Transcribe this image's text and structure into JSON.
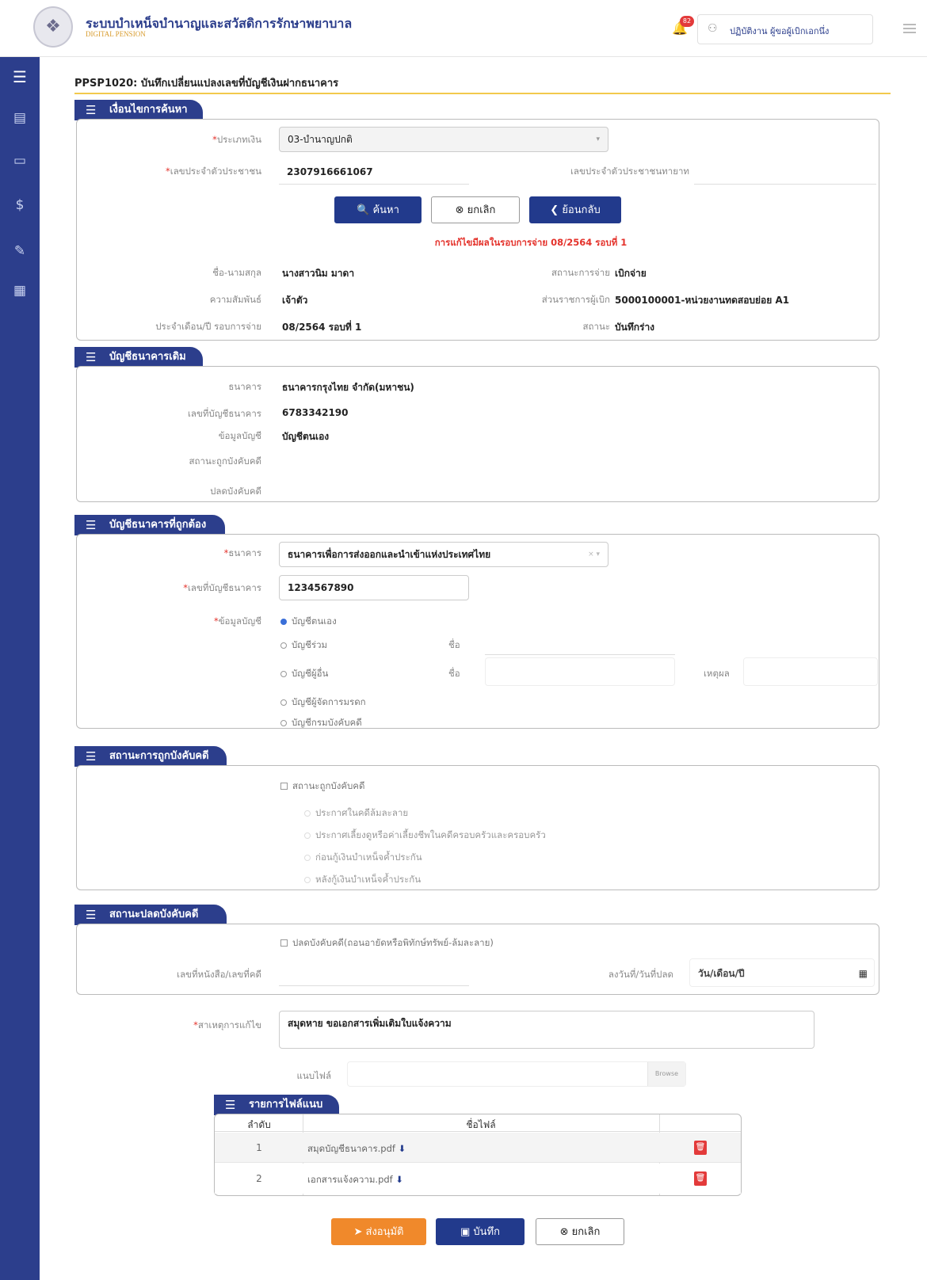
{
  "header": {
    "title": "ระบบบำเหน็จบำนาญและสวัสดิการรักษาพยาบาล",
    "subtitle": "DIGITAL PENSION",
    "notification_count": "82",
    "user_name": "ปฏิบัติงาน ผู้ขอผู้เบิกเอกนึ่ง"
  },
  "page": {
    "title": "PPSP1020: บันทึกเปลี่ยนแปลงเลขที่บัญชีเงินฝากธนาคาร"
  },
  "search": {
    "section_title": "เงื่อนไขการค้นหา",
    "type_label": "ประเภทเงิน",
    "type_value": "03-บำนาญปกติ",
    "id_label": "เลขประจำตัวประชาชน",
    "id_value": "2307916661067",
    "heir_id_label": "เลขประจำตัวประชาชนทายาท",
    "search_btn": "ค้นหา",
    "cancel_btn": "ยกเลิก",
    "back_btn": "ย้อนกลับ",
    "notice": "การแก้ไขมีผลในรอบการจ่าย 08/2564 รอบที่ 1"
  },
  "info": {
    "name_label": "ชื่อ-นามสกุล",
    "name_value": "นางสาวนิม มาดา",
    "pay_status_label": "สถานะการจ่าย",
    "pay_status_value": "เบิกจ่าย",
    "relation_label": "ความสัมพันธ์",
    "relation_value": "เจ้าตัว",
    "unit_label": "ส่วนราชการผู้เบิก",
    "unit_value": "5000100001-หน่วยงานทดสอบย่อย A1",
    "period_label": "ประจำเดือน/ปี รอบการจ่าย",
    "period_value": "08/2564 รอบที่ 1",
    "status_label": "สถานะ",
    "status_value": "บันทึกร่าง"
  },
  "old_bank": {
    "section_title": "บัญชีธนาคารเดิม",
    "bank_label": "ธนาคาร",
    "bank_value": "ธนาคารกรุงไทย จำกัด(มหาชน)",
    "acc_label": "เลขที่บัญชีธนาคาร",
    "acc_value": "6783342190",
    "acc_type_label": "ข้อมูลบัญชี",
    "acc_type_value": "บัญชีตนเอง",
    "enforce_label": "สถานะถูกบังคับคดี",
    "release_label": "ปลดบังคับคดี"
  },
  "new_bank": {
    "section_title": "บัญชีธนาคารที่ถูกต้อง",
    "bank_label": "ธนาคาร",
    "bank_value": "ธนาคารเพื่อการส่งออกและนำเข้าแห่งประเทศไทย",
    "acc_label": "เลขที่บัญชีธนาคาร",
    "acc_value": "1234567890",
    "acc_type_label": "ข้อมูลบัญชี",
    "opt_self": "บัญชีตนเอง",
    "opt_joint": "บัญชีร่วม",
    "opt_other": "บัญชีผู้อื่น",
    "opt_estate": "บัญชีผู้จัดการมรดก",
    "opt_enforce": "บัญชีกรมบังคับคดี",
    "name_label": "ชื่อ",
    "reason_label": "เหตุผล"
  },
  "enforce": {
    "section_title": "สถานะการถูกบังคับคดี",
    "check_label": "สถานะถูกบังคับคดี",
    "opt1": "ประกาศในคดีล้มละลาย",
    "opt2": "ประกาศเลี้ยงดูหรือค่าเลี้ยงชีพในคดีครอบครัวและครอบครัว",
    "opt3": "ก่อนกู้เงินบำเหน็จค้ำประกัน",
    "opt4": "หลังกู้เงินบำเหน็จค้ำประกัน"
  },
  "release": {
    "section_title": "สถานะปลดบังคับคดี",
    "check_label": "ปลดบังคับคดี(ถอนอายัดหรือพิทักษ์ทรัพย์-ล้มละลาย)",
    "doc_label": "เลขที่หนังสือ/เลขที่คดี",
    "date_label": "ลงวันที่/วันที่ปลด",
    "date_placeholder": "วัน/เดือน/ปี"
  },
  "reason": {
    "label": "สาเหตุการแก้ไข",
    "value": "สมุดหาย ขอเอกสารเพิ่มเติมใบแจ้งความ",
    "attach_label": "แนบไฟล์",
    "browse": "Browse"
  },
  "files": {
    "section_title": "รายการไฟล์แนบ",
    "col_no": "ลำดับ",
    "col_name": "ชื่อไฟล์",
    "rows": [
      {
        "no": "1",
        "name": "สมุดบัญชีธนาคาร.pdf"
      },
      {
        "no": "2",
        "name": "เอกสารแจ้งความ.pdf"
      }
    ]
  },
  "footer": {
    "submit_btn": "ส่งอนุมัติ",
    "save_btn": "บันทึก",
    "cancel_btn": "ยกเลิก"
  }
}
